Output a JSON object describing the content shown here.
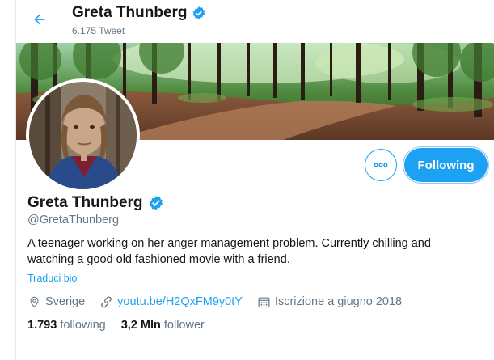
{
  "header": {
    "name": "Greta Thunberg",
    "tweet_count": "6.175 Tweet"
  },
  "colors": {
    "accent": "#1da1f2",
    "muted": "#657786",
    "text": "#14171a"
  },
  "actions": {
    "more_icon": "more-icon",
    "following_label": "Following"
  },
  "profile": {
    "name": "Greta Thunberg",
    "handle": "@GretaThunberg",
    "bio": "A teenager working on her anger management problem. Currently chilling and watching a good old fashioned movie with a friend.",
    "translate_label": "Traduci bio",
    "location": "Sverige",
    "website": "youtu.be/H2QxFM9y0tY",
    "joined": "Iscrizione a giugno 2018"
  },
  "stats": {
    "following_count": "1.793",
    "following_label": "following",
    "followers_count": "3,2 Mln",
    "followers_label": "follower"
  }
}
